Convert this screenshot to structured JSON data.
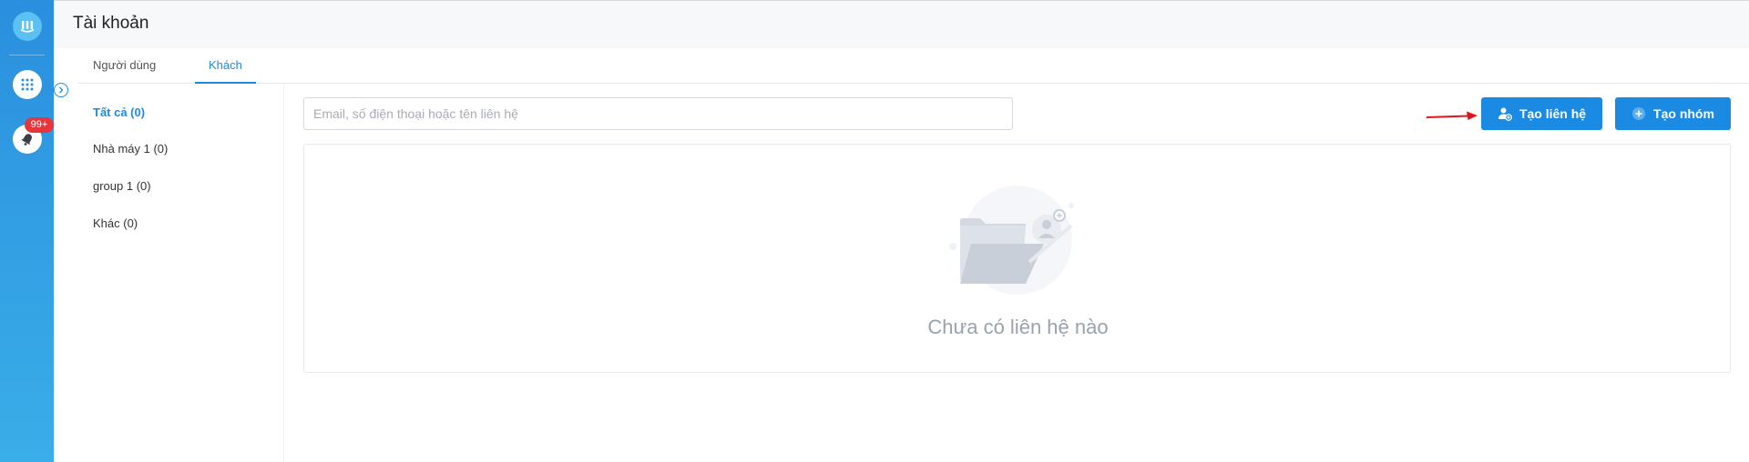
{
  "app": {
    "notification_badge": "99+"
  },
  "header": {
    "title": "Tài khoản"
  },
  "tabs": [
    {
      "label": "Người dùng",
      "active": false
    },
    {
      "label": "Khách",
      "active": true
    }
  ],
  "groups": [
    {
      "label": "Tất cả  (0)",
      "active": true
    },
    {
      "label": "Nhà máy 1  (0)",
      "active": false
    },
    {
      "label": "group 1  (0)",
      "active": false
    },
    {
      "label": "Khác  (0)",
      "active": false
    }
  ],
  "search": {
    "placeholder": "Email, số điện thoại hoặc tên liên hệ",
    "value": ""
  },
  "toolbar": {
    "create_contact_label": "Tạo liên hệ",
    "create_group_label": "Tạo nhóm"
  },
  "empty_state": {
    "message": "Chưa có liên hệ nào"
  },
  "colors": {
    "accent": "#1b8ae3",
    "rail": "#2f9be2",
    "badge": "#e8343b",
    "annotation_arrow": "#e0151b"
  }
}
